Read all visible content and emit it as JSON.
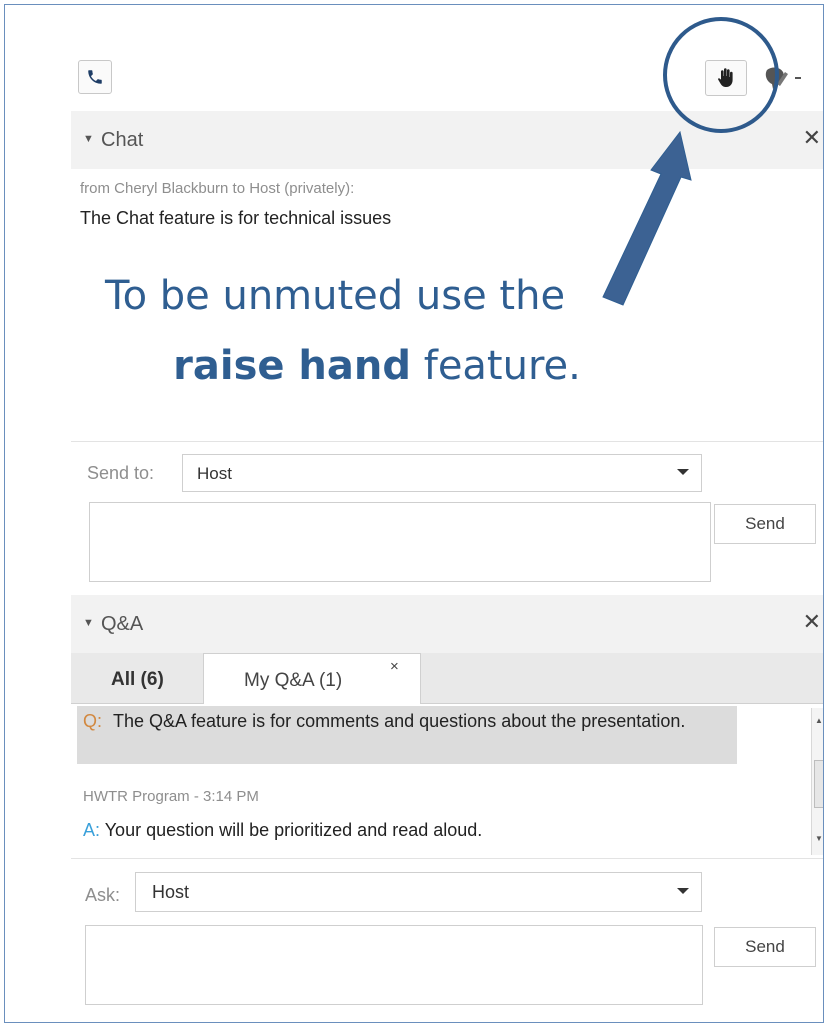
{
  "toolbar": {
    "phone_icon": "phone-icon",
    "raise_hand_icon": "raise-hand-icon",
    "status_icon": "status-dropdown-icon"
  },
  "chat": {
    "title": "Chat",
    "message_meta": "from Cheryl Blackburn to Host (privately):",
    "message_text": "The Chat feature is for technical issues",
    "send_to_label": "Send to:",
    "send_to_value": "Host",
    "send_label": "Send"
  },
  "overlay": {
    "line1": "To be unmuted use the",
    "line2_bold": "raise hand",
    "line2_rest": " feature."
  },
  "qa": {
    "title": "Q&A",
    "tabs": [
      {
        "label": "All (6)",
        "active": false
      },
      {
        "label": "My Q&A (1)",
        "active": true,
        "close": "×"
      }
    ],
    "question_prefix": "Q:",
    "question_text": "The Q&A feature is for comments and questions about the presentation.",
    "answer_meta": "HWTR Program - 3:14 PM",
    "answer_prefix": "A:",
    "answer_text": "Your question will be prioritized and read aloud.",
    "ask_label": "Ask:",
    "ask_value": "Host",
    "send_label": "Send"
  },
  "colors": {
    "accent": "#3c6293",
    "question_prefix": "#d2883f",
    "answer_prefix": "#3aa0da",
    "overlay_text": "#2f5e91"
  }
}
